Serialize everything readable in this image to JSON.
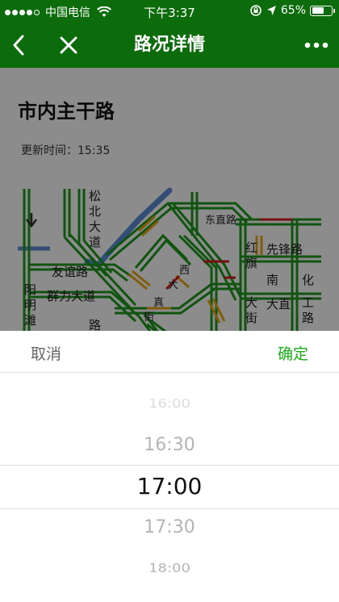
{
  "status_bar": {
    "carrier": "中国电信",
    "time": "下午3:37",
    "battery": "65%",
    "battery_level": 0.65
  },
  "nav": {
    "title": "路况详情",
    "icons": [
      "back-chevron-icon",
      "close-icon",
      "more-dots-icon"
    ]
  },
  "page": {
    "title": "市内主干路",
    "update_label": "更新时间：",
    "update_time": "15:35"
  },
  "map": {
    "labels": {
      "songbei": "松北大道",
      "youyi": "友谊路",
      "qunli": "群力大道",
      "yangming": "阳明滩",
      "dongzhi": "东直路",
      "hongqi": "红旗",
      "xianfeng": "先锋路",
      "nan": "南",
      "hua": "化",
      "dazhi": "大直",
      "gong": "工路",
      "xi": "西",
      "da": "大",
      "zhen": "真",
      "jie": "街",
      "dajie": "大街",
      "lu": "路"
    },
    "colors": {
      "smooth": "#1e9a1e",
      "slow": "#e6a817",
      "congested": "#d22020",
      "river": "#5b8fd6"
    }
  },
  "picker": {
    "cancel": "取消",
    "confirm": "确定",
    "options": [
      "16:00",
      "16:30",
      "17:00",
      "17:30",
      "18:00"
    ],
    "selected": "17:00",
    "accent": "#1aad19"
  }
}
